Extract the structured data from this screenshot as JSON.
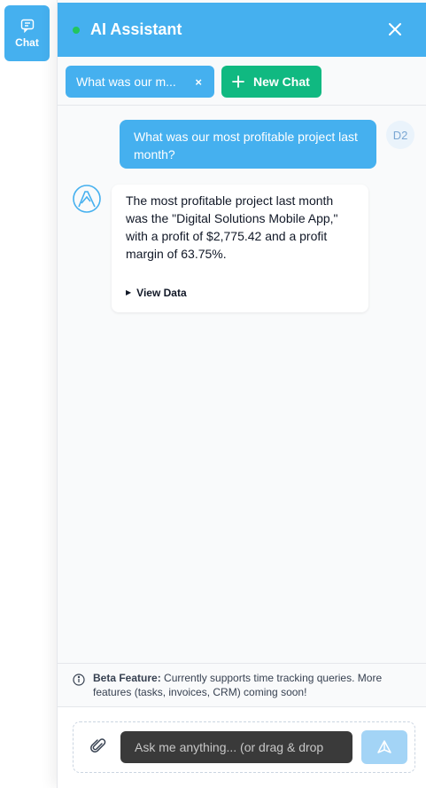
{
  "rail": {
    "chat_label": "Chat",
    "icon": "chat-bubble-icon"
  },
  "header": {
    "title": "AI Assistant",
    "status_color": "#22c55e",
    "accent": "#45b0ef"
  },
  "tabs": {
    "active_chat": "What was our m...",
    "active_chat_close": "×",
    "new_chat_label": "New Chat"
  },
  "messages": {
    "user_text": "What was our most profitable project last month?",
    "user_initials": "D2",
    "bot_text": "The most profitable project last month was the \"Digital Solutions Mobile App,\" with a profit of $2,775.42 and a profit margin of 63.75%.",
    "view_data_label": "View Data"
  },
  "beta": {
    "title": "Beta Feature:",
    "text": " Currently supports time tracking queries. More features (tasks, invoices, CRM) coming soon!"
  },
  "input": {
    "placeholder": "Ask me anything... (or drag & drop"
  },
  "colors": {
    "accent": "#45b0ef",
    "new_chat": "#10b981",
    "send_disabled": "#a3d4f6"
  }
}
